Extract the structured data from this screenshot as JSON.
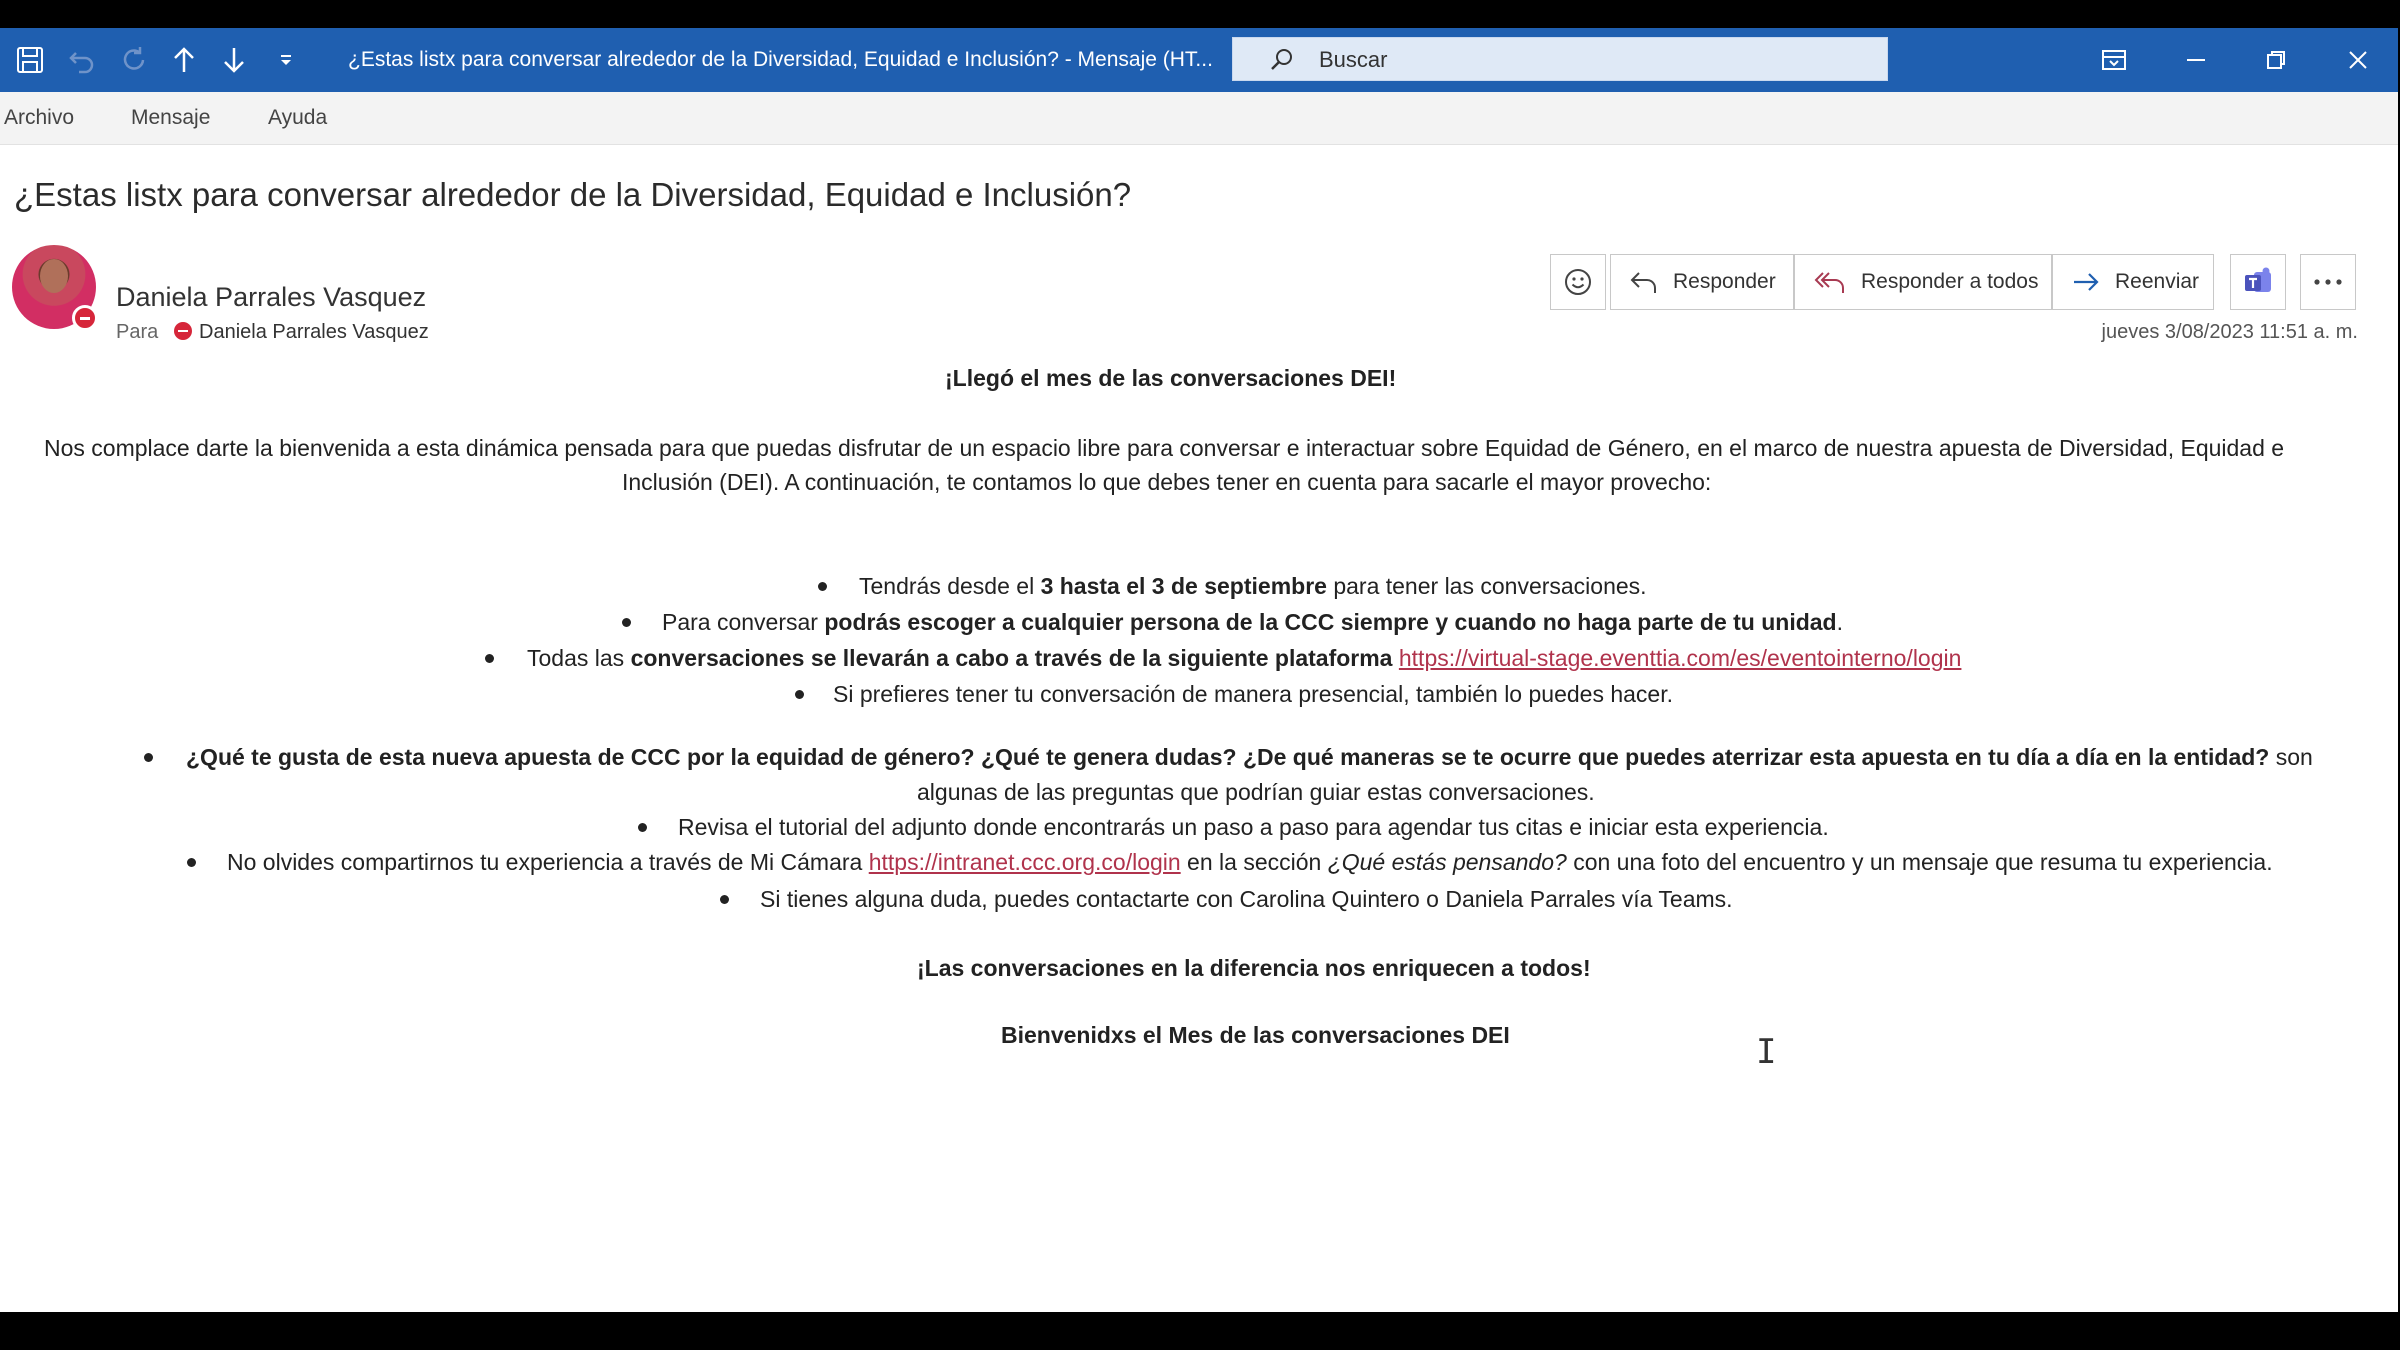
{
  "titlebar": {
    "title": "¿Estas listx para conversar alrededor de la Diversidad, Equidad e Inclusión? - Mensaje (HT...",
    "search_placeholder": "Buscar",
    "bg_color": "#1f5fb0",
    "icons": [
      "save-icon",
      "undo-icon",
      "redo-icon",
      "up-arrow-icon",
      "down-arrow-icon",
      "customize-icon",
      "ribbon-toggle-icon",
      "minimize-icon",
      "restore-icon",
      "close-icon"
    ]
  },
  "menu": {
    "items": [
      "Archivo",
      "Mensaje",
      "Ayuda"
    ]
  },
  "message": {
    "subject": "¿Estas listx para conversar alrededor de la Diversidad, Equidad e Inclusión?",
    "sender": "Daniela Parrales Vasquez",
    "to_label": "Para",
    "recipient": "Daniela Parrales Vasquez",
    "datetime": "jueves 3/08/2023 11:51 a. m."
  },
  "actions": {
    "reply": "Responder",
    "reply_all": "Responder a todos",
    "forward": "Reenviar"
  },
  "body": {
    "heading": "¡Llegó el mes de las conversaciones DEI!",
    "intro_line1": "Nos complace darte la bienvenida a esta dinámica pensada para que puedas disfrutar de un espacio libre para conversar e interactuar sobre Equidad de Género, en el marco de nuestra apuesta de Diversidad, Equidad e",
    "intro_line2": "Inclusión (DEI). A continuación, te contamos lo que debes tener en cuenta para sacarle el mayor provecho:",
    "b1_pre": "Tendrás desde el ",
    "b1_bold": "3 hasta el 3 de septiembre",
    "b1_post": " para tener las conversaciones.",
    "b2_pre": "Para conversar ",
    "b2_bold": "podrás escoger a cualquier persona de la CCC siempre y cuando no haga parte de tu unidad",
    "b2_post": ".",
    "b3_pre": "Todas las ",
    "b3_bold": "conversaciones se llevarán a cabo a través de la siguiente plataforma",
    "b3_link": "https://virtual-stage.eventtia.com/es/eventointerno/login",
    "b4": "Si prefieres tener tu conversación de manera presencial, también lo puedes hacer.",
    "b5_bold": "¿Qué te gusta de esta nueva apuesta de CCC por la equidad de género? ¿Qué te genera dudas? ¿De qué maneras se te ocurre que puedes aterrizar esta apuesta en tu día a día en la entidad?",
    "b5_post": " son",
    "b5_line2": "algunas de las preguntas que podrían guiar estas conversaciones.",
    "b6": "Revisa el tutorial del adjunto donde encontrarás un paso a paso para agendar tus citas e iniciar esta experiencia.",
    "b7_pre": "No olvides compartirnos tu experiencia a través de Mi Cámara ",
    "b7_link": "https://intranet.ccc.org.co/login",
    "b7_mid": " en la sección ",
    "b7_italic": "¿Qué estás pensando?",
    "b7_post": " con una foto del encuentro y un mensaje que resuma tu experiencia.",
    "b8": "Si tienes alguna duda, puedes contactarte con Carolina Quintero o Daniela Parrales vía Teams.",
    "closing1": "¡Las conversaciones en la diferencia nos enriquecen a todos!",
    "closing2": "Bienvenidxs el Mes de las conversaciones DEI"
  }
}
